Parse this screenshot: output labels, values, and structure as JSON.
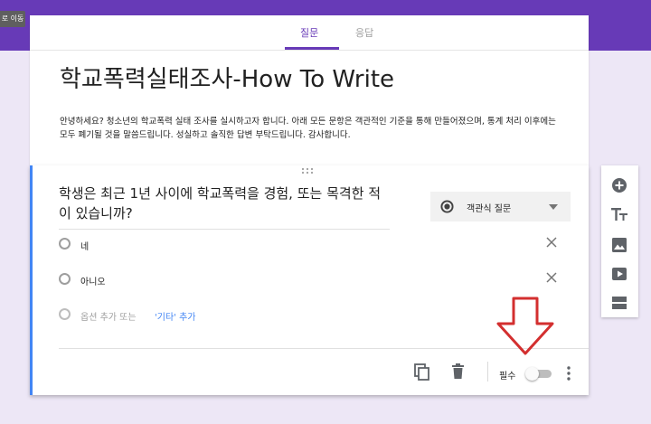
{
  "corner": {
    "label": "로 이동"
  },
  "tabs": [
    {
      "label": "질문",
      "active": true
    },
    {
      "label": "응답",
      "active": false
    }
  ],
  "form": {
    "title": "학교폭력실태조사-How To Write",
    "description": "안녕하세요? 청소년의 학교폭력 실태 조사를 실시하고자 합니다. 아래 모든 문항은 객관적인 기준을 통해 만들어졌으며, 통계 처리 이후에는 모두 폐기될 것을 말씀드립니다. 성실하고 솔직한 답변 부탁드립니다. 감사합니다."
  },
  "question": {
    "text": "학생은 최근 1년 사이에 학교폭력을 경험, 또는 목격한 적이 있습니까?",
    "type_label": "객관식 질문",
    "options": [
      {
        "label": "네"
      },
      {
        "label": "아니오"
      }
    ],
    "add_option": {
      "label": "옵션 추가 또는",
      "other_label": "'기타' 추가"
    },
    "required_label": "필수",
    "required": false
  },
  "colors": {
    "header": "#673ab7",
    "background": "#ede7f6",
    "accent_bar": "#4285f4",
    "arrow": "#d32f2f"
  },
  "icons": {
    "footer": [
      "copy-icon",
      "trash-icon",
      "more-vert-icon"
    ],
    "toolbar": [
      "add-circle-icon",
      "title-text-icon",
      "image-icon",
      "video-icon",
      "section-icon"
    ]
  }
}
